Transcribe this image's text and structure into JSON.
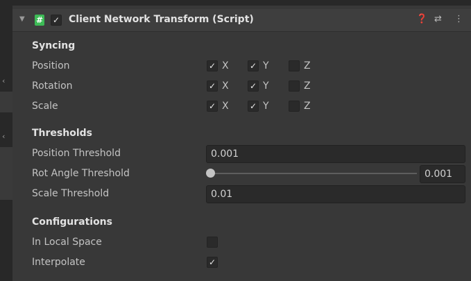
{
  "header": {
    "foldout_glyph": "▼",
    "script_icon_glyph": "#",
    "enabled_check": "✓",
    "title": "Client Network Transform (Script)",
    "help_glyph": "❓",
    "presets_glyph": "⇄",
    "menu_glyph": "⋮"
  },
  "syncing": {
    "title": "Syncing",
    "rows": [
      {
        "label": "Position",
        "x": true,
        "y": true,
        "z": false
      },
      {
        "label": "Rotation",
        "x": true,
        "y": true,
        "z": false
      },
      {
        "label": "Scale",
        "x": true,
        "y": true,
        "z": false
      }
    ],
    "axis_labels": {
      "x": "X",
      "y": "Y",
      "z": "Z"
    }
  },
  "thresholds": {
    "title": "Thresholds",
    "position_label": "Position Threshold",
    "position_value": "0.001",
    "rot_label": "Rot Angle Threshold",
    "rot_value": "0.001",
    "scale_label": "Scale Threshold",
    "scale_value": "0.01"
  },
  "configurations": {
    "title": "Configurations",
    "local_space_label": "In Local Space",
    "local_space_checked": false,
    "interpolate_label": "Interpolate",
    "interpolate_checked": true
  },
  "check_glyph": "✓",
  "colors": {
    "script_icon": "#3dbb56",
    "background": "#383838"
  }
}
